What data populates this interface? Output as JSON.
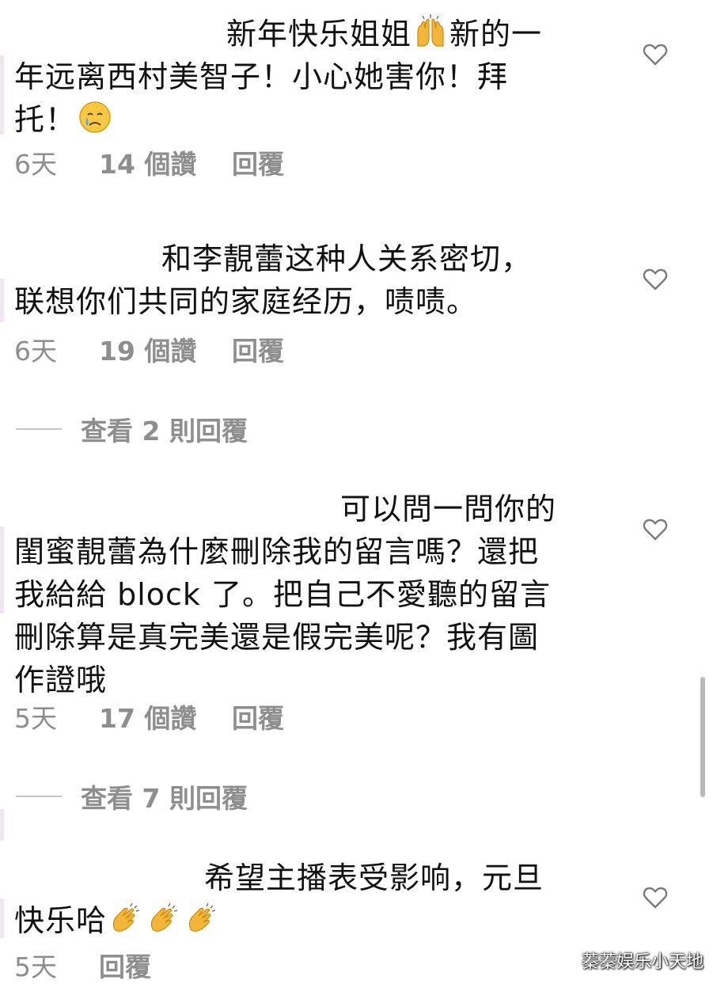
{
  "comments": [
    {
      "text_line1": "新年快乐姐姐",
      "text_after_emoji": "新的一",
      "text_rest": "年远离西村美智子！小心她害你！拜\n托！",
      "emoji1": "raising-hands-icon",
      "emoji2": "crying-face-icon",
      "age": "6天",
      "likes": "14 個讚",
      "reply": "回覆"
    },
    {
      "text_line1": "和李靚蕾这种人关系密切，",
      "text_rest": "联想你们共同的家庭经历，啧啧。",
      "age": "6天",
      "likes": "19 個讚",
      "reply": "回覆",
      "view_replies": "查看 2 則回覆"
    },
    {
      "text_line1": "可以問一問你的",
      "text_rest": "閨蜜靚蕾為什麼刪除我的留言嗎？還把\n我給給 block 了。把自己不愛聽的留言\n刪除算是真完美還是假完美呢？我有圖\n作證哦",
      "age": "5天",
      "likes": "17 個讚",
      "reply": "回覆",
      "view_replies": "查看 7 則回覆"
    },
    {
      "text_line1": "希望主播表受影响，元旦",
      "text_rest": "快乐哈",
      "emoji": "clapping-hands-icon",
      "age": "5天",
      "reply": "回覆"
    }
  ],
  "icons": {
    "like": "heart-outline-icon"
  },
  "watermark": "蓁蓁娱乐小天地",
  "colors": {
    "meta_text": "#8e8e8e",
    "body_text": "#111111",
    "scrollbar": "#b9b9b9"
  }
}
